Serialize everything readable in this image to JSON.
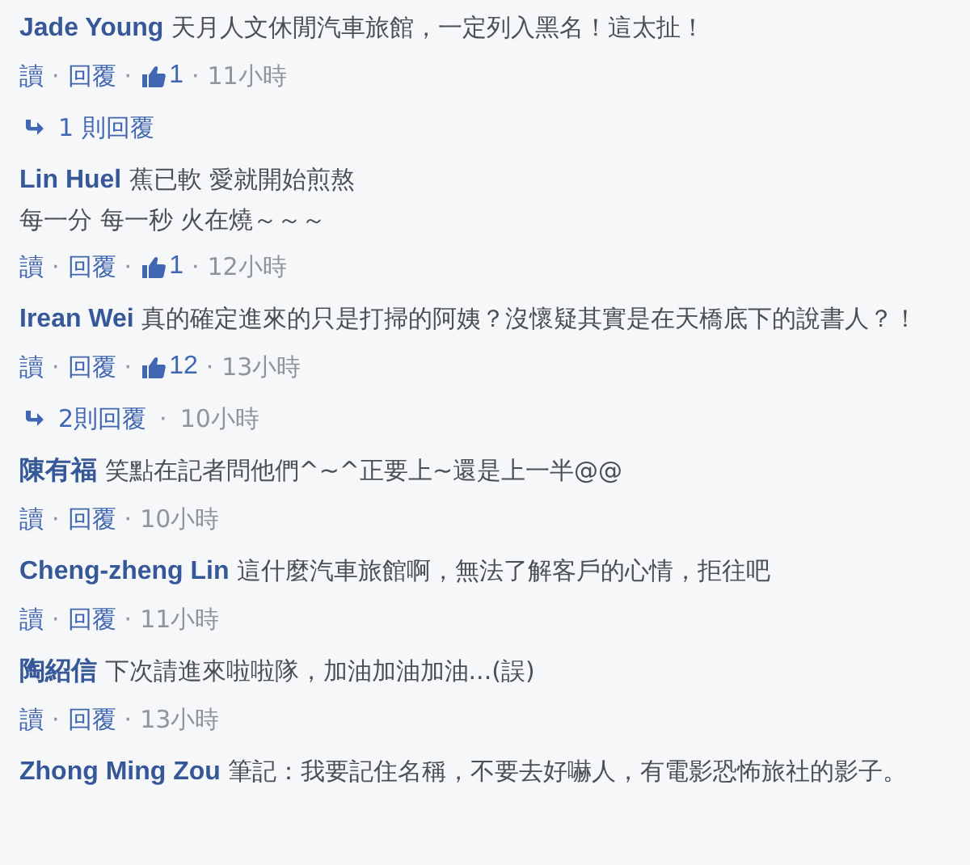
{
  "separator": "·",
  "comments": [
    {
      "author": "Jade Young",
      "lines": [
        "天月人文休閒汽車旅館，一定列入黑名！這太扯！"
      ],
      "actions": [
        "讀",
        "回覆"
      ],
      "likes": "1",
      "time": "11小時",
      "replies": {
        "label": "1 則回覆"
      }
    },
    {
      "author": "Lin Huel",
      "lines": [
        "蕉已軟 愛就開始煎熬",
        "每一分 每一秒 火在燒～～～"
      ],
      "actions": [
        "讀",
        "回覆"
      ],
      "likes": "1",
      "time": "12小時"
    },
    {
      "author": "Irean Wei",
      "lines": [
        "真的確定進來的只是打掃的阿姨？沒懷疑其實是在天橋底下的說書人？！"
      ],
      "actions": [
        "讀",
        "回覆"
      ],
      "likes": "12",
      "time": "13小時",
      "replies": {
        "label": "2則回覆",
        "time": "10小時"
      }
    },
    {
      "author": "陳有福",
      "lines": [
        "笑點在記者問他們^~^正要上~還是上一半@@"
      ],
      "actions": [
        "讀",
        "回覆"
      ],
      "time": "10小時"
    },
    {
      "author": "Cheng-zheng Lin",
      "lines": [
        "這什麼汽車旅館啊，無法了解客戶的心情，拒往吧"
      ],
      "actions": [
        "讀",
        "回覆"
      ],
      "time": "11小時"
    },
    {
      "author": "陶紹信",
      "lines": [
        "下次請進來啦啦隊，加油加油加油...(誤)"
      ],
      "actions": [
        "讀",
        "回覆"
      ],
      "time": "13小時"
    },
    {
      "author": "Zhong Ming Zou",
      "lines": [
        "筆記：我要記住名稱，不要去好嚇人，有電影恐怖旅社的影子。"
      ]
    }
  ]
}
